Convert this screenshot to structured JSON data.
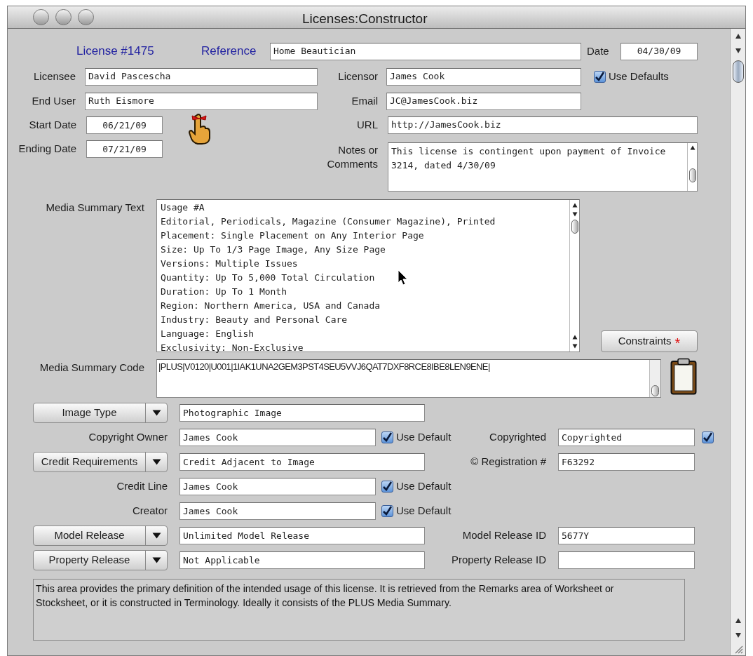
{
  "window": {
    "title": "Licenses:Constructor"
  },
  "license_number": "License #1475",
  "reference": {
    "label": "Reference",
    "value": "Home Beautician"
  },
  "date": {
    "label": "Date",
    "value": "04/30/09"
  },
  "licensee": {
    "label": "Licensee",
    "value": "David Pascescha"
  },
  "licensor": {
    "label": "Licensor",
    "value": "James Cook"
  },
  "use_defaults": {
    "label": "Use Defaults",
    "checked": true
  },
  "end_user": {
    "label": "End User",
    "value": "Ruth Eismore"
  },
  "email": {
    "label": "Email",
    "value": "JC@JamesCook.biz"
  },
  "start_date": {
    "label": "Start Date",
    "value": "06/21/09"
  },
  "ending_date": {
    "label": "Ending Date",
    "value": "07/21/09"
  },
  "url": {
    "label": "URL",
    "value": "http://JamesCook.biz"
  },
  "notes": {
    "label": "Notes or Comments",
    "value": "This license is contingent upon payment of Invoice 3214, dated 4/30/09"
  },
  "media_summary_text": {
    "label": "Media Summary Text",
    "lines": [
      "Usage #A",
      "Editorial, Periodicals, Magazine (Consumer Magazine), Printed",
      "Placement: Single Placement on Any Interior Page",
      "Size: Up To 1/3 Page Image, Any Size Page",
      "Versions: Multiple Issues",
      "Quantity: Up To 5,000 Total Circulation",
      "Duration: Up To 1 Month",
      "Region: Northern America, USA and Canada",
      "Industry: Beauty and Personal Care",
      "Language: English",
      "Exclusivity: Non-Exclusive"
    ]
  },
  "constraints": {
    "label": "Constraints",
    "required_mark": "*"
  },
  "media_summary_code": {
    "label": "Media Summary Code",
    "value": "|PLUS|V0120|U001|1IAK1UNA2GEM3PST4SEU5VVJ6QAT7DXF8RCE8IBE8LEN9ENE|"
  },
  "rights_rows": [
    {
      "left": {
        "kind": "dropdown",
        "label": "Image Type",
        "value": "Photographic Image"
      }
    },
    {
      "left": {
        "kind": "label",
        "label": "Copyright Owner",
        "value": "James Cook",
        "use_default": {
          "label": "Use Default",
          "checked": true
        }
      },
      "right": {
        "label": "Copyrighted",
        "value": "Copyrighted",
        "checked": true
      }
    },
    {
      "left": {
        "kind": "dropdown",
        "label": "Credit Requirements",
        "value": "Credit Adjacent to Image"
      },
      "right": {
        "label": "© Registration #",
        "value": "F63292"
      }
    },
    {
      "left": {
        "kind": "label",
        "label": "Credit Line",
        "value": "James Cook",
        "use_default": {
          "label": "Use Default",
          "checked": true
        }
      }
    },
    {
      "left": {
        "kind": "label",
        "label": "Creator",
        "value": "James Cook",
        "use_default": {
          "label": "Use Default",
          "checked": true
        }
      }
    },
    {
      "left": {
        "kind": "dropdown",
        "label": "Model Release",
        "value": "Unlimited Model Release"
      },
      "right": {
        "label": "Model Release ID",
        "value": "5677Y"
      }
    },
    {
      "left": {
        "kind": "dropdown",
        "label": "Property Release",
        "value": "Not Applicable"
      },
      "right": {
        "label": "Property Release ID"
      }
    }
  ],
  "help_text": "This area provides the primary definition of the intended usage of this license. It is retrieved from the Remarks area of Worksheet or Stocksheet, or it is constructed in Terminology. Ideally it consists of the PLUS Media Summary."
}
